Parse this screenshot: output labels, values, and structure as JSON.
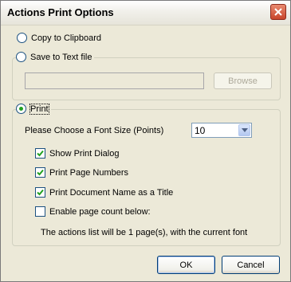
{
  "window": {
    "title": "Actions Print Options"
  },
  "options": {
    "copy_to_clipboard": "Copy to Clipboard",
    "save_to_text_file": "Save to Text file",
    "browse": "Browse",
    "print": "Print"
  },
  "print_group": {
    "font_size_label": "Please Choose a Font Size (Points)",
    "font_size_value": "10",
    "checkboxes": [
      {
        "label": "Show Print Dialog",
        "checked": true
      },
      {
        "label": "Print Page Numbers",
        "checked": true
      },
      {
        "label": "Print Document Name as a Title",
        "checked": true
      },
      {
        "label": "Enable page count below:",
        "checked": false
      }
    ],
    "page_count_text": "The actions list will be 1 page(s), with the current font"
  },
  "buttons": {
    "ok": "OK",
    "cancel": "Cancel"
  },
  "selected_option": "print",
  "colors": {
    "dialog_bg": "#ece9d8",
    "radio_dot": "#21a121",
    "check_mark": "#21a121"
  }
}
